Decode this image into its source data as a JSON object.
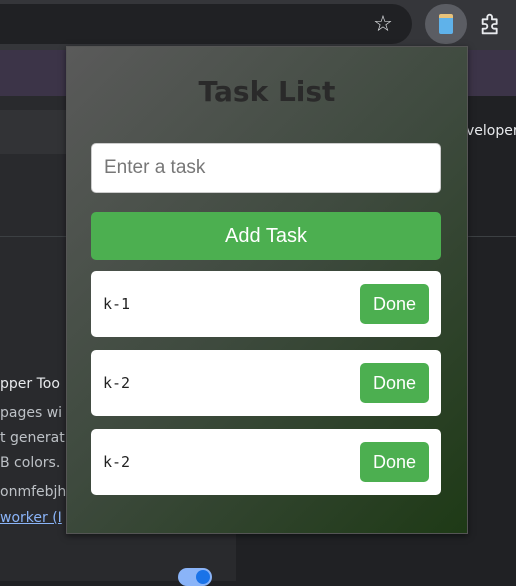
{
  "browser": {
    "bookmark_icon": "star-icon",
    "active_extension_icon": "jar-icon",
    "extensions_icon": "puzzle-icon"
  },
  "background_page": {
    "right_snippet": "veloper",
    "extension_name": "pper Too",
    "desc_line1": "pages wi",
    "desc_line2": "t generat",
    "desc_line3": "B colors.",
    "extension_id": "onmfebjh",
    "service_worker_link": "worker (I"
  },
  "popup": {
    "title": "Task List",
    "input": {
      "value": "",
      "placeholder": "Enter a task"
    },
    "add_button_label": "Add Task",
    "tasks": [
      {
        "label": "k-1",
        "done_label": "Done"
      },
      {
        "label": "k-2",
        "done_label": "Done"
      },
      {
        "label": "k-2",
        "done_label": "Done"
      }
    ]
  },
  "colors": {
    "accent": "#4caf50",
    "popup_gradient_start": "#5a5a5a",
    "popup_gradient_end": "#1e3a16"
  }
}
